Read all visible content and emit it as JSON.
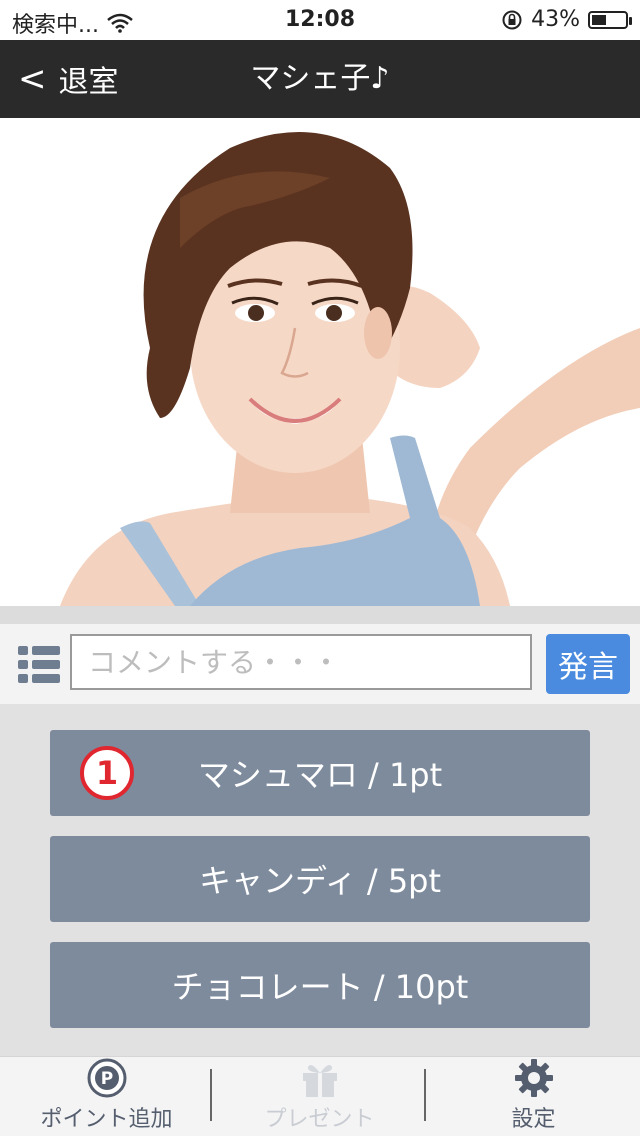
{
  "status_bar": {
    "carrier": "検索中...",
    "time": "12:08",
    "battery": "43%",
    "battery_level": 0.43
  },
  "nav": {
    "back_label": "退室",
    "back_chevron": "<",
    "title": "マシェ子♪"
  },
  "comment": {
    "placeholder": "コメントする・・・",
    "value": "",
    "post_label": "発言"
  },
  "gifts": [
    {
      "label": "マシュマロ / 1pt",
      "badge": "1"
    },
    {
      "label": "キャンディ / 5pt",
      "badge": ""
    },
    {
      "label": "チョコレート / 10pt",
      "badge": ""
    }
  ],
  "tabbar": {
    "items": [
      {
        "label": "ポイント追加",
        "icon": "points-icon",
        "enabled": true
      },
      {
        "label": "プレゼント",
        "icon": "gift-icon",
        "enabled": false
      },
      {
        "label": "設定",
        "icon": "gear-icon",
        "enabled": true
      }
    ]
  },
  "colors": {
    "nav_bg": "#2a2a2a",
    "post_button": "#4a8be0",
    "gift_button": "#7e8b9c",
    "badge_red": "#e0262f"
  }
}
